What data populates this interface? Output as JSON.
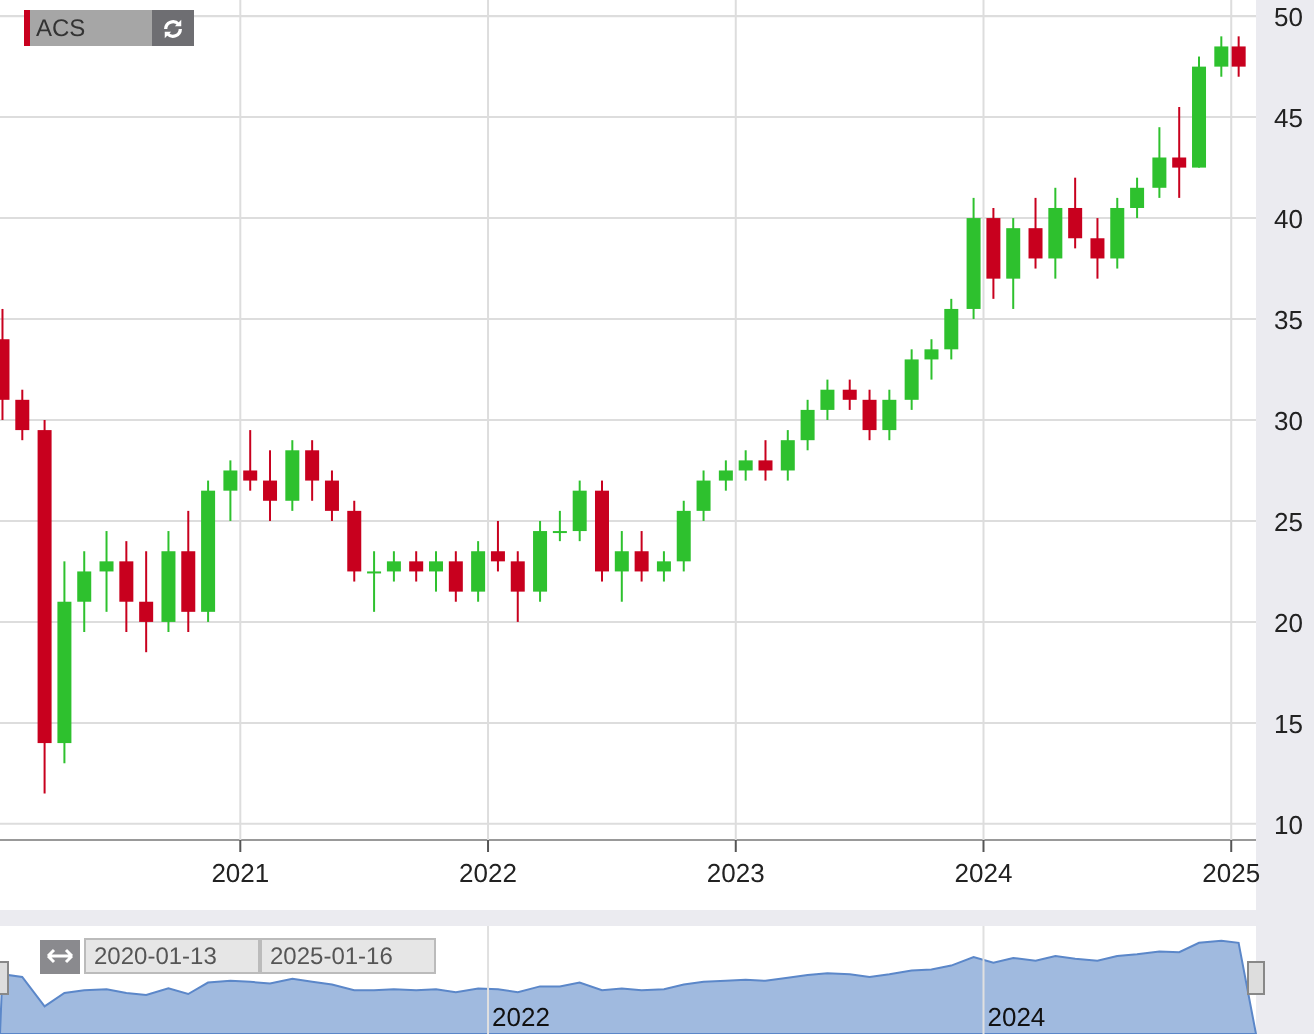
{
  "ticker": {
    "symbol": "ACS"
  },
  "chart_data": {
    "type": "candlestick",
    "x": [
      2020.04,
      2020.12,
      2020.21,
      2020.29,
      2020.37,
      2020.46,
      2020.54,
      2020.62,
      2020.71,
      2020.79,
      2020.87,
      2020.96,
      2021.04,
      2021.12,
      2021.21,
      2021.29,
      2021.37,
      2021.46,
      2021.54,
      2021.62,
      2021.71,
      2021.79,
      2021.87,
      2021.96,
      2022.04,
      2022.12,
      2022.21,
      2022.29,
      2022.37,
      2022.46,
      2022.54,
      2022.62,
      2022.71,
      2022.79,
      2022.87,
      2022.96,
      2023.04,
      2023.12,
      2023.21,
      2023.29,
      2023.37,
      2023.46,
      2023.54,
      2023.62,
      2023.71,
      2023.79,
      2023.87,
      2023.96,
      2024.04,
      2024.12,
      2024.21,
      2024.29,
      2024.37,
      2024.46,
      2024.54,
      2024.62,
      2024.71,
      2024.79,
      2024.87,
      2024.96,
      2025.03
    ],
    "ohlc": [
      [
        34,
        35.5,
        30,
        31
      ],
      [
        31,
        31.5,
        29,
        29.5
      ],
      [
        29.5,
        30,
        11.5,
        14
      ],
      [
        14,
        23,
        13,
        21
      ],
      [
        21,
        23.5,
        19.5,
        22.5
      ],
      [
        22.5,
        24.5,
        20.5,
        23
      ],
      [
        23,
        24,
        19.5,
        21
      ],
      [
        21,
        23.5,
        18.5,
        20
      ],
      [
        20,
        24.5,
        19.5,
        23.5
      ],
      [
        23.5,
        25.5,
        19.5,
        20.5
      ],
      [
        20.5,
        27,
        20,
        26.5
      ],
      [
        26.5,
        28,
        25,
        27.5
      ],
      [
        27.5,
        29.5,
        26.5,
        27
      ],
      [
        27,
        28.5,
        25,
        26
      ],
      [
        26,
        29,
        25.5,
        28.5
      ],
      [
        28.5,
        29,
        26,
        27
      ],
      [
        27,
        27.5,
        25,
        25.5
      ],
      [
        25.5,
        26,
        22,
        22.5
      ],
      [
        22.5,
        23.5,
        20.5,
        22.5
      ],
      [
        22.5,
        23.5,
        22,
        23
      ],
      [
        23,
        23.5,
        22,
        22.5
      ],
      [
        22.5,
        23.5,
        21.5,
        23
      ],
      [
        23,
        23.5,
        21,
        21.5
      ],
      [
        21.5,
        24,
        21,
        23.5
      ],
      [
        23.5,
        25,
        22.5,
        23
      ],
      [
        23,
        23.5,
        20,
        21.5
      ],
      [
        21.5,
        25,
        21,
        24.5
      ],
      [
        24.5,
        25.5,
        24,
        24.5
      ],
      [
        24.5,
        27,
        24,
        26.5
      ],
      [
        26.5,
        27,
        22,
        22.5
      ],
      [
        22.5,
        24.5,
        21,
        23.5
      ],
      [
        23.5,
        24.5,
        22,
        22.5
      ],
      [
        22.5,
        23.5,
        22,
        23
      ],
      [
        23,
        26,
        22.5,
        25.5
      ],
      [
        25.5,
        27.5,
        25,
        27
      ],
      [
        27,
        28,
        26.5,
        27.5
      ],
      [
        27.5,
        28.5,
        27,
        28
      ],
      [
        28,
        29,
        27,
        27.5
      ],
      [
        27.5,
        29.5,
        27,
        29
      ],
      [
        29,
        31,
        28.5,
        30.5
      ],
      [
        30.5,
        32,
        30,
        31.5
      ],
      [
        31.5,
        32,
        30.5,
        31
      ],
      [
        31,
        31.5,
        29,
        29.5
      ],
      [
        29.5,
        31.5,
        29,
        31
      ],
      [
        31,
        33.5,
        30.5,
        33
      ],
      [
        33,
        34,
        32,
        33.5
      ],
      [
        33.5,
        36,
        33,
        35.5
      ],
      [
        35.5,
        41,
        35,
        40
      ],
      [
        40,
        40.5,
        36,
        37
      ],
      [
        37,
        40,
        35.5,
        39.5
      ],
      [
        39.5,
        41,
        37.5,
        38
      ],
      [
        38,
        41.5,
        37,
        40.5
      ],
      [
        40.5,
        42,
        38.5,
        39
      ],
      [
        39,
        40,
        37,
        38
      ],
      [
        38,
        41,
        37.5,
        40.5
      ],
      [
        40.5,
        42,
        40,
        41.5
      ],
      [
        41.5,
        44.5,
        41,
        43
      ],
      [
        43,
        45.5,
        41,
        42.5
      ],
      [
        42.5,
        48,
        42.5,
        47.5
      ],
      [
        47.5,
        49,
        47,
        48.5
      ],
      [
        48.5,
        49,
        47,
        47.5
      ]
    ],
    "xlim": [
      2020.03,
      2025.1
    ],
    "ylim": [
      9.2,
      50.8
    ],
    "grid": true,
    "xticks": [
      {
        "value": 2021,
        "label": "2021"
      },
      {
        "value": 2022,
        "label": "2022"
      },
      {
        "value": 2023,
        "label": "2023"
      },
      {
        "value": 2024,
        "label": "2024"
      },
      {
        "value": 2025,
        "label": "2025"
      }
    ],
    "yticks": [
      10,
      15,
      20,
      25,
      30,
      35,
      40,
      45,
      50
    ]
  },
  "navigator": {
    "start_date": "2020-01-13",
    "end_date": "2025-01-16",
    "labels": [
      "2022",
      "2024"
    ]
  }
}
